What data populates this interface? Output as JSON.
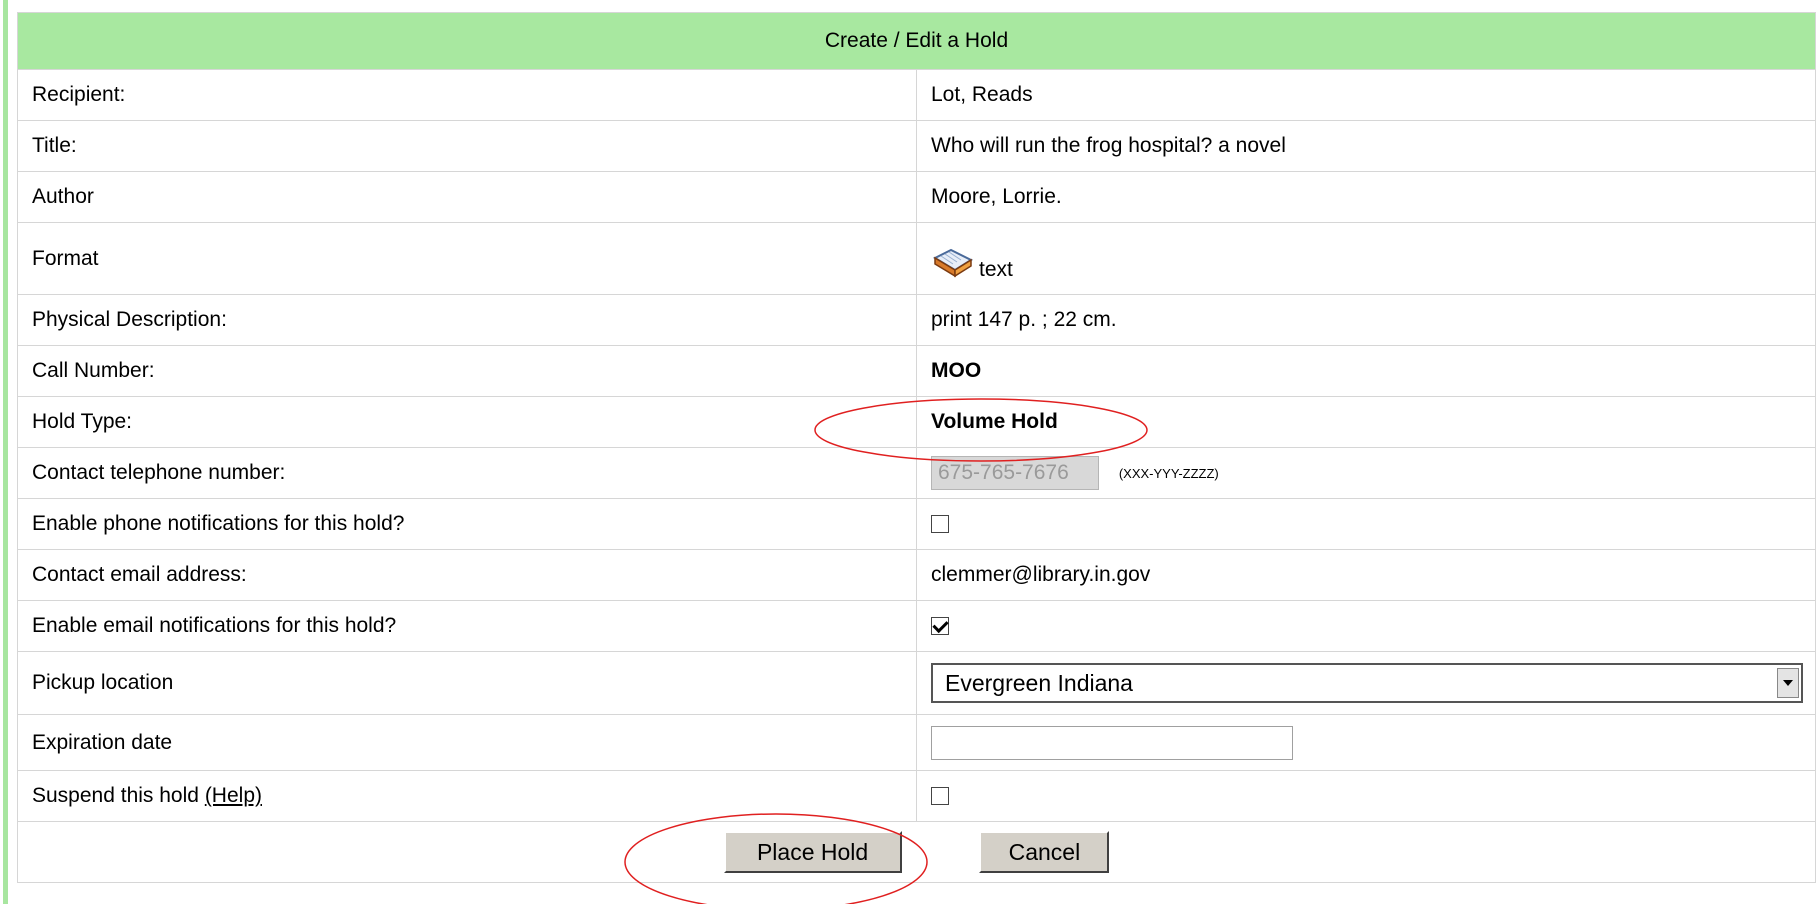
{
  "form": {
    "title": "Create / Edit a Hold",
    "recipient": {
      "label": "Recipient:",
      "value": "Lot, Reads"
    },
    "title_field": {
      "label": "Title:",
      "value": "Who will run the frog hospital? a novel"
    },
    "author": {
      "label": "Author",
      "value": "Moore, Lorrie."
    },
    "format": {
      "label": "Format",
      "value": "text",
      "icon": "book-icon"
    },
    "physical": {
      "label": "Physical Description:",
      "value": "print 147 p. ; 22 cm."
    },
    "call_number": {
      "label": "Call Number:",
      "value": "MOO"
    },
    "hold_type": {
      "label": "Hold Type:",
      "value": "Volume Hold"
    },
    "phone": {
      "label": "Contact telephone number:",
      "value": "675-765-7676",
      "hint": "(XXX-YYY-ZZZZ)"
    },
    "phone_notify": {
      "label": "Enable phone notifications for this hold?",
      "checked": false
    },
    "email": {
      "label": "Contact email address:",
      "value": "clemmer@library.in.gov"
    },
    "email_notify": {
      "label": "Enable email notifications for this hold?",
      "checked": true
    },
    "pickup": {
      "label": "Pickup location",
      "selected": "Evergreen Indiana"
    },
    "expiration": {
      "label": "Expiration date",
      "value": ""
    },
    "suspend": {
      "label": "Suspend this hold",
      "help_link": "(Help)",
      "checked": false
    },
    "buttons": {
      "place": "Place Hold",
      "cancel": "Cancel"
    }
  },
  "colors": {
    "header_bg": "#a8e8a0",
    "annotation": "#e02020"
  }
}
